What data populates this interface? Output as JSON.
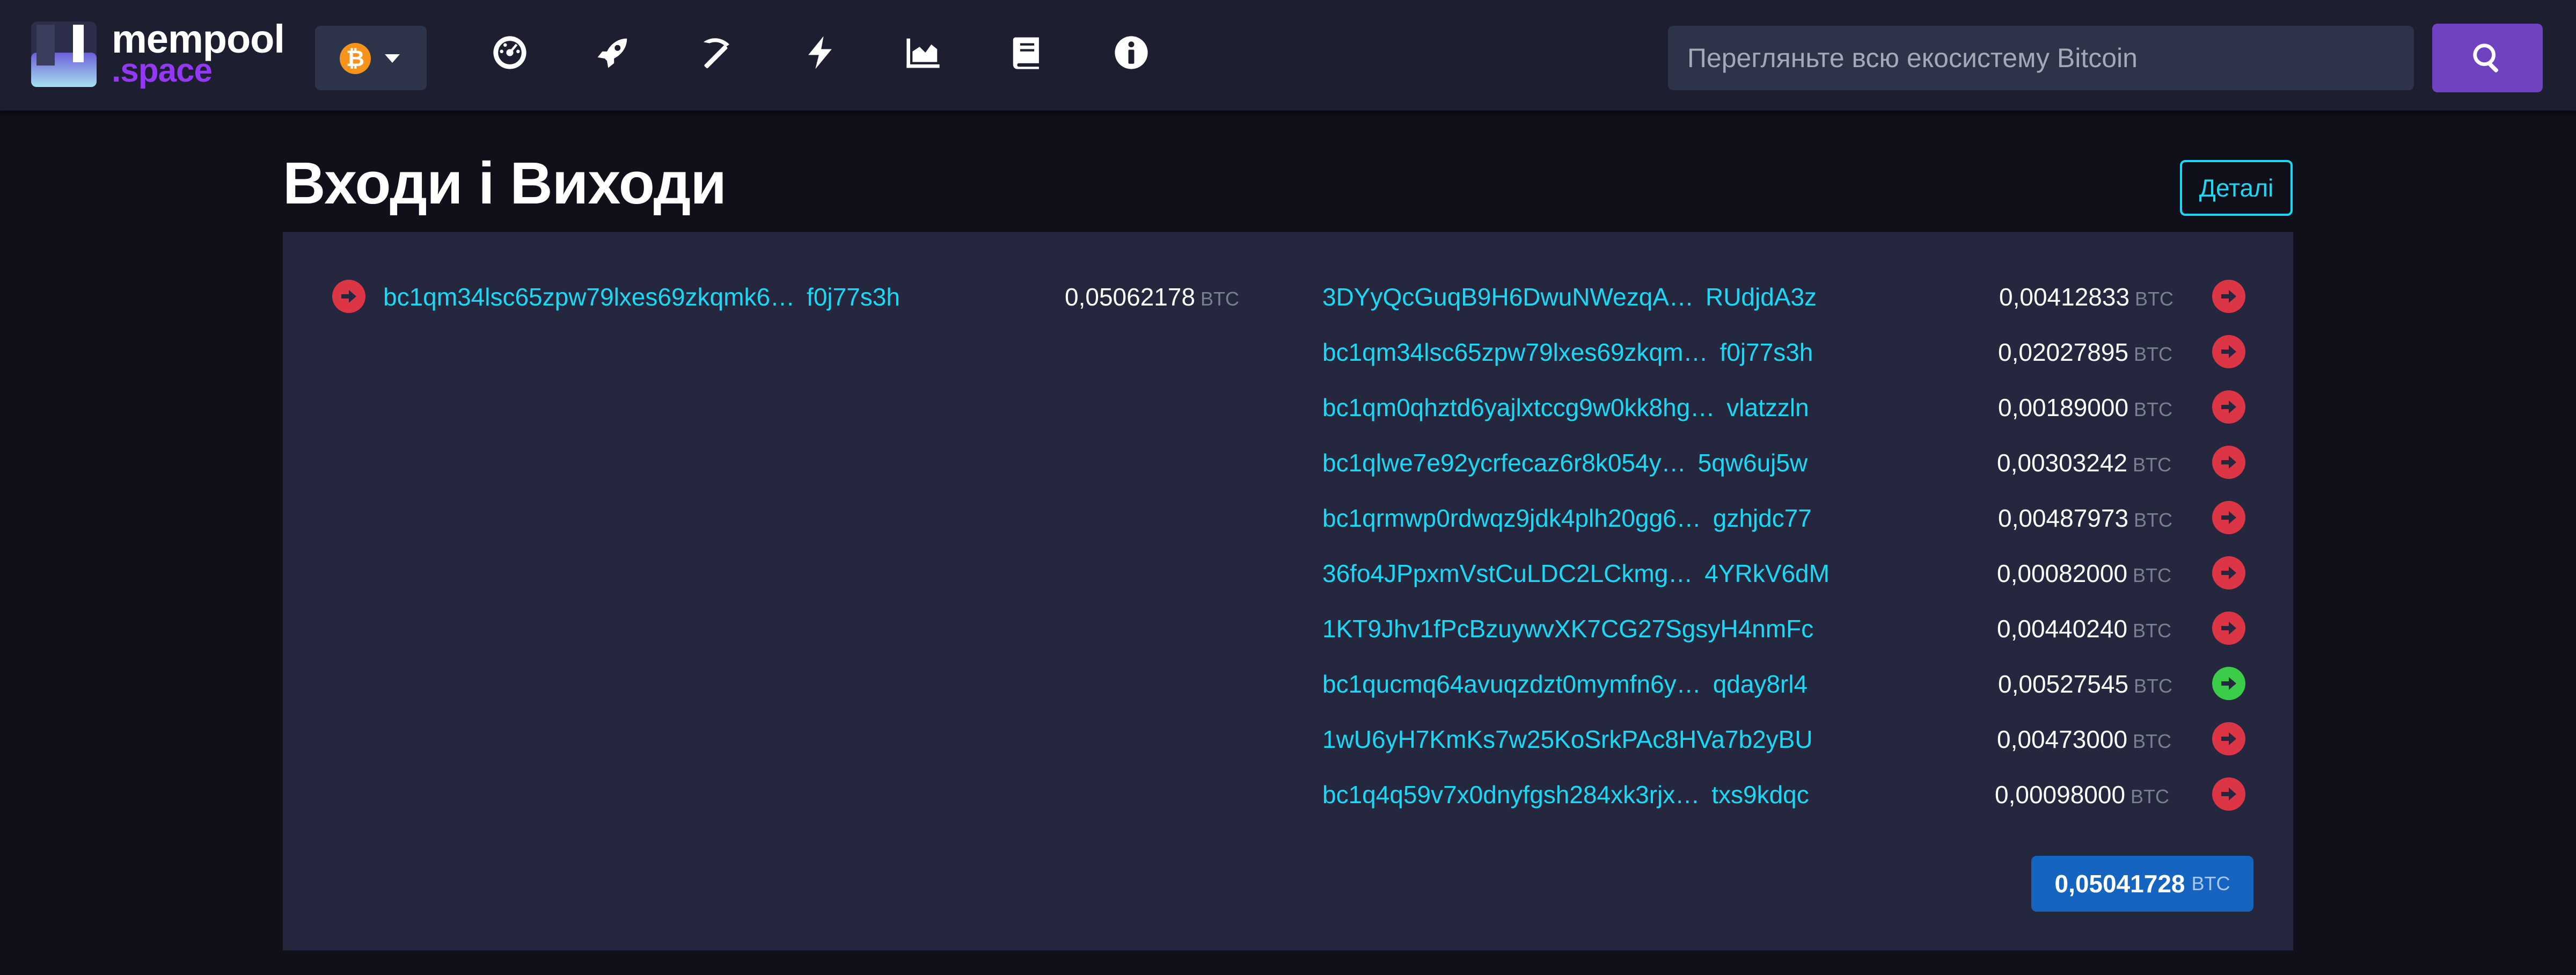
{
  "brand": {
    "line1": "mempool",
    "line2": ".space"
  },
  "network": {
    "symbol": "₿",
    "icon": "bitcoin-icon"
  },
  "nav": [
    {
      "name": "dashboard-icon"
    },
    {
      "name": "rocket-icon"
    },
    {
      "name": "pickaxe-icon"
    },
    {
      "name": "lightning-icon"
    },
    {
      "name": "chart-icon"
    },
    {
      "name": "book-icon"
    },
    {
      "name": "info-icon"
    }
  ],
  "search": {
    "placeholder": "Перегляньте всю екосистему Bitcoin",
    "value": ""
  },
  "page": {
    "title": "Входи і Виходи",
    "details_label": "Деталі"
  },
  "unit": "BTC",
  "inputs": [
    {
      "address": "bc1qm34lsc65zpw79lxes69zkqmk6…",
      "tail": "f0j77s3h",
      "amount": "0,05062178",
      "arrow": "red"
    }
  ],
  "outputs": [
    {
      "address": "3DYyQcGuqB9H6DwuNWezqA…",
      "tail": "RUdjdA3z",
      "amount": "0,00412833",
      "arrow": "red"
    },
    {
      "address": "bc1qm34lsc65zpw79lxes69zkqm…",
      "tail": "f0j77s3h",
      "amount": "0,02027895",
      "arrow": "red"
    },
    {
      "address": "bc1qm0qhztd6yajlxtccg9w0kk8hg…",
      "tail": "vlatzzln",
      "amount": "0,00189000",
      "arrow": "red"
    },
    {
      "address": "bc1qlwe7e92ycrfecaz6r8k054y…",
      "tail": "5qw6uj5w",
      "amount": "0,00303242",
      "arrow": "red"
    },
    {
      "address": "bc1qrmwp0rdwqz9jdk4plh20gg6…",
      "tail": "gzhjdc77",
      "amount": "0,00487973",
      "arrow": "red"
    },
    {
      "address": "36fo4JPpxmVstCuLDC2LCkmg…",
      "tail": "4YRkV6dM",
      "amount": "0,00082000",
      "arrow": "red"
    },
    {
      "address": "1KT9Jhv1fPcBzuywvXK7CG27SgsyH4nmFc",
      "tail": "",
      "amount": "0,00440240",
      "arrow": "red"
    },
    {
      "address": "bc1qucmq64avuqzdzt0mymfn6y…",
      "tail": "qday8rl4",
      "amount": "0,00527545",
      "arrow": "green"
    },
    {
      "address": "1wU6yH7KmKs7w25KoSrkPAc8HVa7b2yBU",
      "tail": "",
      "amount": "0,00473000",
      "arrow": "red"
    },
    {
      "address": "bc1q4q59v7x0dnyfgsh284xk3rjx…",
      "tail": "txs9kdqc",
      "amount": "0,00098000",
      "arrow": "red"
    }
  ],
  "total": {
    "amount": "0,05041728"
  },
  "colors": {
    "accent_cyan": "#1bd8f4",
    "arrow_red": "#dc3545",
    "arrow_green": "#3bcc49",
    "search_button": "#6f42c1",
    "total_badge": "#1564c0"
  }
}
